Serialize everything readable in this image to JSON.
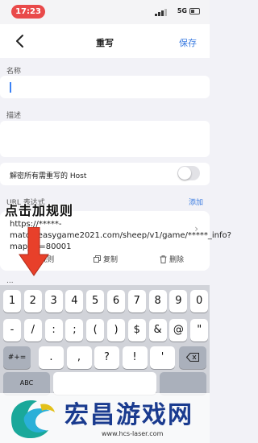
{
  "status_bar": {
    "time": "17:23",
    "network": "5G"
  },
  "nav": {
    "title": "重写",
    "save_label": "保存"
  },
  "form": {
    "name_label": "名称",
    "desc_label": "描述",
    "decrypt_host_label": "解密所有需重写的 Host",
    "decrypt_host_enabled": false,
    "url_label": "URL 表达式",
    "add_label": "添加",
    "rule_url": "https://*****-match.easygame2021.com/sheep/v1/game/*****_info?map_id=80001",
    "actions": {
      "add_rule": "加规则",
      "copy": "复制",
      "delete": "删除"
    },
    "next_section_label": "..."
  },
  "annotation": {
    "text": "点击加规则"
  },
  "keyboard": {
    "row1": [
      "1",
      "2",
      "3",
      "4",
      "5",
      "6",
      "7",
      "8",
      "9",
      "0"
    ],
    "row2": [
      "-",
      "/",
      ":",
      ";",
      "(",
      ")",
      "$",
      "&",
      "@",
      "\""
    ],
    "row3_left": "#+=",
    "row3": [
      ".",
      ",",
      "?",
      "!",
      "'"
    ],
    "bottom_left": "ABC",
    "space": "",
    "return": ""
  },
  "watermark": {
    "title": "宏昌游戏网",
    "url": "www.hcs-laser.com"
  },
  "colors": {
    "accent": "#3a7be0",
    "status_pill": "#e94a4a",
    "arrow": "#e8402a"
  }
}
